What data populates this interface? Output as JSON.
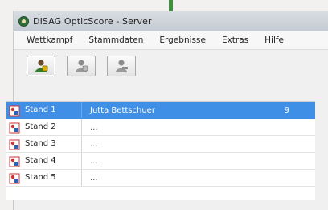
{
  "app": {
    "title": "DISAG OpticScore - Server"
  },
  "menu": {
    "items": [
      "Wettkampf",
      "Stammdaten",
      "Ergebnisse",
      "Extras",
      "Hilfe"
    ]
  },
  "toolbar": {
    "buttons": [
      {
        "icon": "shooter-active-icon"
      },
      {
        "icon": "shooter-icon"
      },
      {
        "icon": "shooter-remove-icon"
      }
    ]
  },
  "stands": [
    {
      "label": "Stand 1",
      "name": "Jutta Bettschuer",
      "value": "9",
      "selected": true
    },
    {
      "label": "Stand 2",
      "name": "...",
      "value": "",
      "selected": false
    },
    {
      "label": "Stand 3",
      "name": "...",
      "value": "",
      "selected": false
    },
    {
      "label": "Stand 4",
      "name": "...",
      "value": "",
      "selected": false
    },
    {
      "label": "Stand 5",
      "name": "...",
      "value": "",
      "selected": false
    }
  ],
  "colors": {
    "selection": "#3f8fe6",
    "accent": "#3f8f3f"
  }
}
